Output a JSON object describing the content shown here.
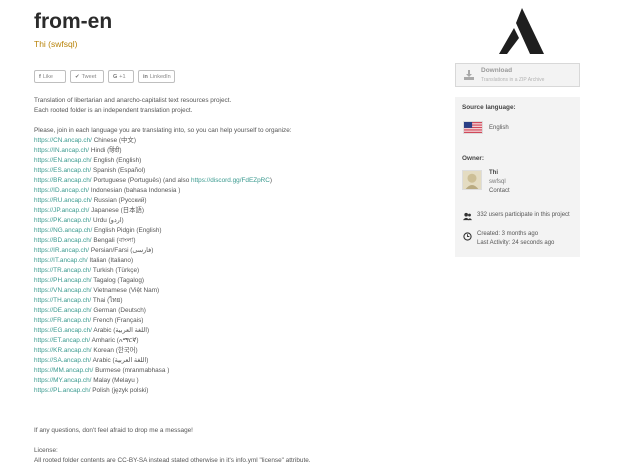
{
  "header": {
    "title": "from-en",
    "subtitle": "Thi (swfsql)"
  },
  "share": {
    "like": "Like",
    "tweet": "Tweet",
    "gplus": "+1",
    "linkedin": "LinkedIn"
  },
  "description": {
    "line1": "Translation of libertarian and anarcho-capitalist text resources project.",
    "line2": "Each rooted folder is an independent translation project.",
    "join": "Please, join in each language you are translating into, so you can help yourself to organize:",
    "languages": [
      {
        "url": "https://CN.ancap.ch/",
        "label": "Chinese (中文)"
      },
      {
        "url": "https://IN.ancap.ch/",
        "label": "Hindi (हिंदी)"
      },
      {
        "url": "https://EN.ancap.ch/",
        "label": "English (English)"
      },
      {
        "url": "https://ES.ancap.ch/",
        "label": "Spanish (Español)"
      },
      {
        "url": "https://BR.ancap.ch/",
        "label": "Portuguese (Português) (and also ",
        "extra_url": "https://discord.gg/FdEZpRC",
        "extra_after": ")"
      },
      {
        "url": "https://ID.ancap.ch/",
        "label": "Indonesian (bahasa Indonesia )"
      },
      {
        "url": "https://RU.ancap.ch/",
        "label": "Russian (Русский)"
      },
      {
        "url": "https://JP.ancap.ch/",
        "label": "Japanese (日本語)"
      },
      {
        "url": "https://PK.ancap.ch/",
        "label": "Urdu (اردو)"
      },
      {
        "url": "https://NG.ancap.ch/",
        "label": "English Pidgin (English)"
      },
      {
        "url": "https://BD.ancap.ch/",
        "label": "Bengali (বাংলা)"
      },
      {
        "url": "https://IR.ancap.ch/",
        "label": "Persian/Farsi (فارسی)"
      },
      {
        "url": "https://IT.ancap.ch/",
        "label": "Italian (Italiano)"
      },
      {
        "url": "https://TR.ancap.ch/",
        "label": "Turkish (Türkçe)"
      },
      {
        "url": "https://PH.ancap.ch/",
        "label": "Tagalog (Tagalog)"
      },
      {
        "url": "https://VN.ancap.ch/",
        "label": "Vietnamese (Việt Nam)"
      },
      {
        "url": "https://TH.ancap.ch/",
        "label": "Thai (ไทย)"
      },
      {
        "url": "https://DE.ancap.ch/",
        "label": "German (Deutsch)"
      },
      {
        "url": "https://FR.ancap.ch/",
        "label": "French (Français)"
      },
      {
        "url": "https://EG.ancap.ch/",
        "label": "Arabic (اللغة العربية)"
      },
      {
        "url": "https://ET.ancap.ch/",
        "label": "Amharic (አማርኛ)"
      },
      {
        "url": "https://KR.ancap.ch/",
        "label": "Korean (한국어)"
      },
      {
        "url": "https://SA.ancap.ch/",
        "label": "Arabic (اللغة العربية)"
      },
      {
        "url": "https://MM.ancap.ch/",
        "label": "Burmese (mranmabhasa )"
      },
      {
        "url": "https://MY.ancap.ch/",
        "label": "Malay (Melayu )"
      },
      {
        "url": "https://PL.ancap.ch/",
        "label": "Polish (język polski)"
      }
    ],
    "questions": "If any questions, don't feel afraid to drop me a message!",
    "license_title": "License:",
    "license_text": "All rooted folder contents are CC-BY-SA instead stated otherwise in it's info.yml \"license\" attribute."
  },
  "download": {
    "label": "Download",
    "sublabel": "Translations in a ZIP Archive"
  },
  "sidebar": {
    "source_heading": "Source language:",
    "source_language": "English",
    "owner_heading": "Owner:",
    "owner_name": "Thi",
    "owner_handle": "swfsql",
    "contact": "Contact",
    "users_text": "332 users participate in this project",
    "created": "Created: 3 months ago",
    "last_activity": "Last Activity: 24 seconds ago"
  },
  "colors": {
    "accent": "#3a9a8f",
    "subtitle": "#b8830a",
    "panel_bg": "#f3f3f3"
  }
}
